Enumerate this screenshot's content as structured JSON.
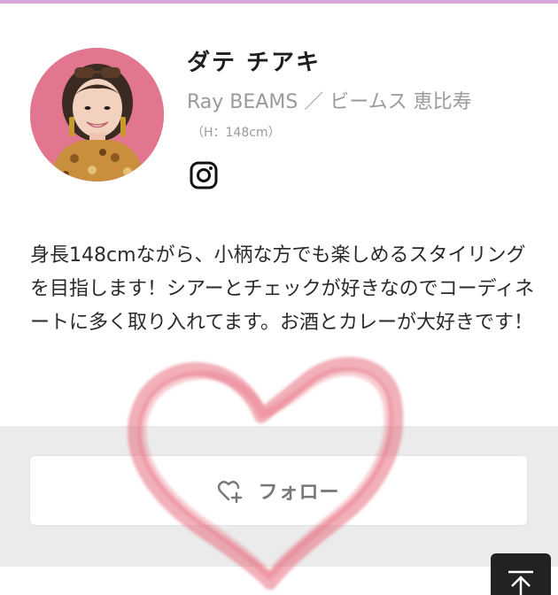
{
  "profile": {
    "name": "ダテ チアキ",
    "shop": "Ray BEAMS ／ ビームス 恵比寿",
    "height": "（H：148cm）",
    "avatar_icon": "person-photo",
    "instagram_icon": "instagram-icon"
  },
  "bio": {
    "text": "身長148cmながら、小柄な方でも楽しめるスタイリングを目指します！シアーとチェックが好きなのでコーディネートに多く取り入れてます。お酒とカレーが大好きです！"
  },
  "follow": {
    "label": "フォロー",
    "icon": "heart-plus-icon"
  },
  "scroll_top": {
    "icon": "arrow-up-icon"
  },
  "colors": {
    "accent_stripe": "#d9a3dd",
    "band": "#ebebeb",
    "heart_overlay": "#e8707f",
    "avatar_bg": "#e3768f"
  }
}
